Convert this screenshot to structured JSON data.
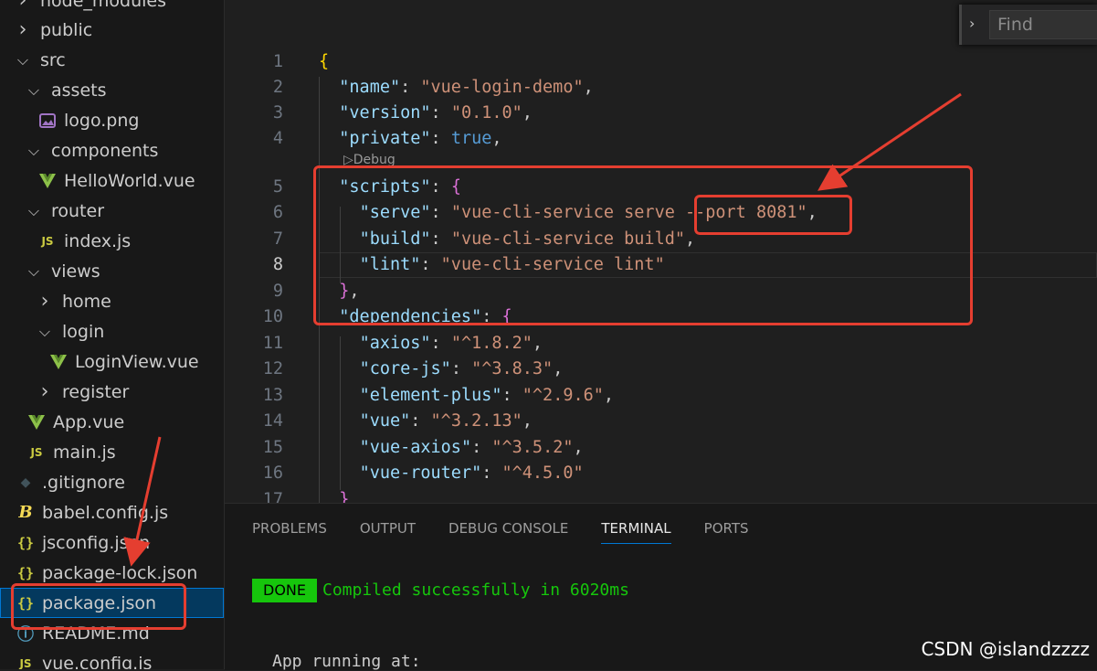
{
  "explorer": {
    "items": [
      {
        "label": "node_modules",
        "icon": "chevron-right-icon",
        "depth": 0,
        "type": "folder"
      },
      {
        "label": "public",
        "icon": "chevron-right-icon",
        "depth": 0,
        "type": "folder"
      },
      {
        "label": "src",
        "icon": "chevron-down-icon",
        "depth": 0,
        "type": "folder"
      },
      {
        "label": "assets",
        "icon": "chevron-down-icon",
        "depth": 1,
        "type": "folder"
      },
      {
        "label": "logo.png",
        "icon": "image-file-icon",
        "depth": 2,
        "type": "file"
      },
      {
        "label": "components",
        "icon": "chevron-down-icon",
        "depth": 1,
        "type": "folder"
      },
      {
        "label": "HelloWorld.vue",
        "icon": "vue-file-icon",
        "depth": 2,
        "type": "file"
      },
      {
        "label": "router",
        "icon": "chevron-down-icon",
        "depth": 1,
        "type": "folder"
      },
      {
        "label": "index.js",
        "icon": "js-file-icon",
        "depth": 2,
        "type": "file"
      },
      {
        "label": "views",
        "icon": "chevron-down-icon",
        "depth": 1,
        "type": "folder"
      },
      {
        "label": "home",
        "icon": "chevron-right-icon",
        "depth": 2,
        "type": "folder"
      },
      {
        "label": "login",
        "icon": "chevron-down-icon",
        "depth": 2,
        "type": "folder"
      },
      {
        "label": "LoginView.vue",
        "icon": "vue-file-icon",
        "depth": 3,
        "type": "file"
      },
      {
        "label": "register",
        "icon": "chevron-right-icon",
        "depth": 2,
        "type": "folder"
      },
      {
        "label": "App.vue",
        "icon": "vue-file-icon",
        "depth": 1,
        "type": "file"
      },
      {
        "label": "main.js",
        "icon": "js-file-icon",
        "depth": 1,
        "type": "file"
      },
      {
        "label": ".gitignore",
        "icon": "git-file-icon",
        "depth": 0,
        "type": "file"
      },
      {
        "label": "babel.config.js",
        "icon": "babel-file-icon",
        "depth": 0,
        "type": "file"
      },
      {
        "label": "jsconfig.json",
        "icon": "json-file-icon",
        "depth": 0,
        "type": "file"
      },
      {
        "label": "package-lock.json",
        "icon": "json-file-icon",
        "depth": 0,
        "type": "file"
      },
      {
        "label": "package.json",
        "icon": "json-file-icon",
        "depth": 0,
        "type": "file",
        "selected": true
      },
      {
        "label": "README.md",
        "icon": "info-file-icon",
        "depth": 0,
        "type": "file"
      },
      {
        "label": "vue.config.js",
        "icon": "js-file-icon",
        "depth": 0,
        "type": "file"
      }
    ]
  },
  "find": {
    "placeholder": "Find"
  },
  "editor": {
    "codelens": "▷Debug",
    "active_line": 8,
    "lines": [
      {
        "n": "1",
        "indent": 0,
        "tokens": [
          [
            "br1",
            "{"
          ]
        ]
      },
      {
        "n": "2",
        "indent": 1,
        "tokens": [
          [
            "k",
            "\"name\""
          ],
          [
            "p",
            ": "
          ],
          [
            "s",
            "\"vue-login-demo\""
          ],
          [
            "p",
            ","
          ]
        ]
      },
      {
        "n": "3",
        "indent": 1,
        "tokens": [
          [
            "k",
            "\"version\""
          ],
          [
            "p",
            ": "
          ],
          [
            "s",
            "\"0.1.0\""
          ],
          [
            "p",
            ","
          ]
        ]
      },
      {
        "n": "4",
        "indent": 1,
        "tokens": [
          [
            "k",
            "\"private\""
          ],
          [
            "p",
            ": "
          ],
          [
            "b",
            "true"
          ],
          [
            "p",
            ","
          ]
        ]
      },
      {
        "n": "5",
        "indent": 1,
        "tokens": [
          [
            "k",
            "\"scripts\""
          ],
          [
            "p",
            ": "
          ],
          [
            "br2",
            "{"
          ]
        ]
      },
      {
        "n": "6",
        "indent": 2,
        "tokens": [
          [
            "k",
            "\"serve\""
          ],
          [
            "p",
            ": "
          ],
          [
            "s",
            "\"vue-cli-service serve --port 8081\""
          ],
          [
            "p",
            ","
          ]
        ]
      },
      {
        "n": "7",
        "indent": 2,
        "tokens": [
          [
            "k",
            "\"build\""
          ],
          [
            "p",
            ": "
          ],
          [
            "s",
            "\"vue-cli-service build\""
          ],
          [
            "p",
            ","
          ]
        ]
      },
      {
        "n": "8",
        "indent": 2,
        "tokens": [
          [
            "k",
            "\"lint\""
          ],
          [
            "p",
            ": "
          ],
          [
            "s",
            "\"vue-cli-service lint\""
          ]
        ]
      },
      {
        "n": "9",
        "indent": 1,
        "tokens": [
          [
            "br2",
            "}"
          ],
          [
            "p",
            ","
          ]
        ]
      },
      {
        "n": "10",
        "indent": 1,
        "tokens": [
          [
            "k",
            "\"dependencies\""
          ],
          [
            "p",
            ": "
          ],
          [
            "br2",
            "{"
          ]
        ]
      },
      {
        "n": "11",
        "indent": 2,
        "tokens": [
          [
            "k",
            "\"axios\""
          ],
          [
            "p",
            ": "
          ],
          [
            "s",
            "\"^1.8.2\""
          ],
          [
            "p",
            ","
          ]
        ]
      },
      {
        "n": "12",
        "indent": 2,
        "tokens": [
          [
            "k",
            "\"core-js\""
          ],
          [
            "p",
            ": "
          ],
          [
            "s",
            "\"^3.8.3\""
          ],
          [
            "p",
            ","
          ]
        ]
      },
      {
        "n": "13",
        "indent": 2,
        "tokens": [
          [
            "k",
            "\"element-plus\""
          ],
          [
            "p",
            ": "
          ],
          [
            "s",
            "\"^2.9.6\""
          ],
          [
            "p",
            ","
          ]
        ]
      },
      {
        "n": "14",
        "indent": 2,
        "tokens": [
          [
            "k",
            "\"vue\""
          ],
          [
            "p",
            ": "
          ],
          [
            "s",
            "\"^3.2.13\""
          ],
          [
            "p",
            ","
          ]
        ]
      },
      {
        "n": "15",
        "indent": 2,
        "tokens": [
          [
            "k",
            "\"vue-axios\""
          ],
          [
            "p",
            ": "
          ],
          [
            "s",
            "\"^3.5.2\""
          ],
          [
            "p",
            ","
          ]
        ]
      },
      {
        "n": "16",
        "indent": 2,
        "tokens": [
          [
            "k",
            "\"vue-router\""
          ],
          [
            "p",
            ": "
          ],
          [
            "s",
            "\"^4.5.0\""
          ]
        ]
      },
      {
        "n": "17",
        "indent": 1,
        "tokens": [
          [
            "br2",
            "}"
          ]
        ]
      }
    ]
  },
  "panel": {
    "tabs": [
      "PROBLEMS",
      "OUTPUT",
      "DEBUG CONSOLE",
      "TERMINAL",
      "PORTS"
    ],
    "active_tab": "TERMINAL",
    "terminal": {
      "badge": "DONE",
      "message": "Compiled successfully in 6020ms",
      "app_running": "App running at:"
    }
  },
  "watermark": "CSDN @islandzzzz",
  "colors": {
    "annotation": "#e53e30",
    "selection": "#04395e",
    "done_green": "#16c60c"
  }
}
